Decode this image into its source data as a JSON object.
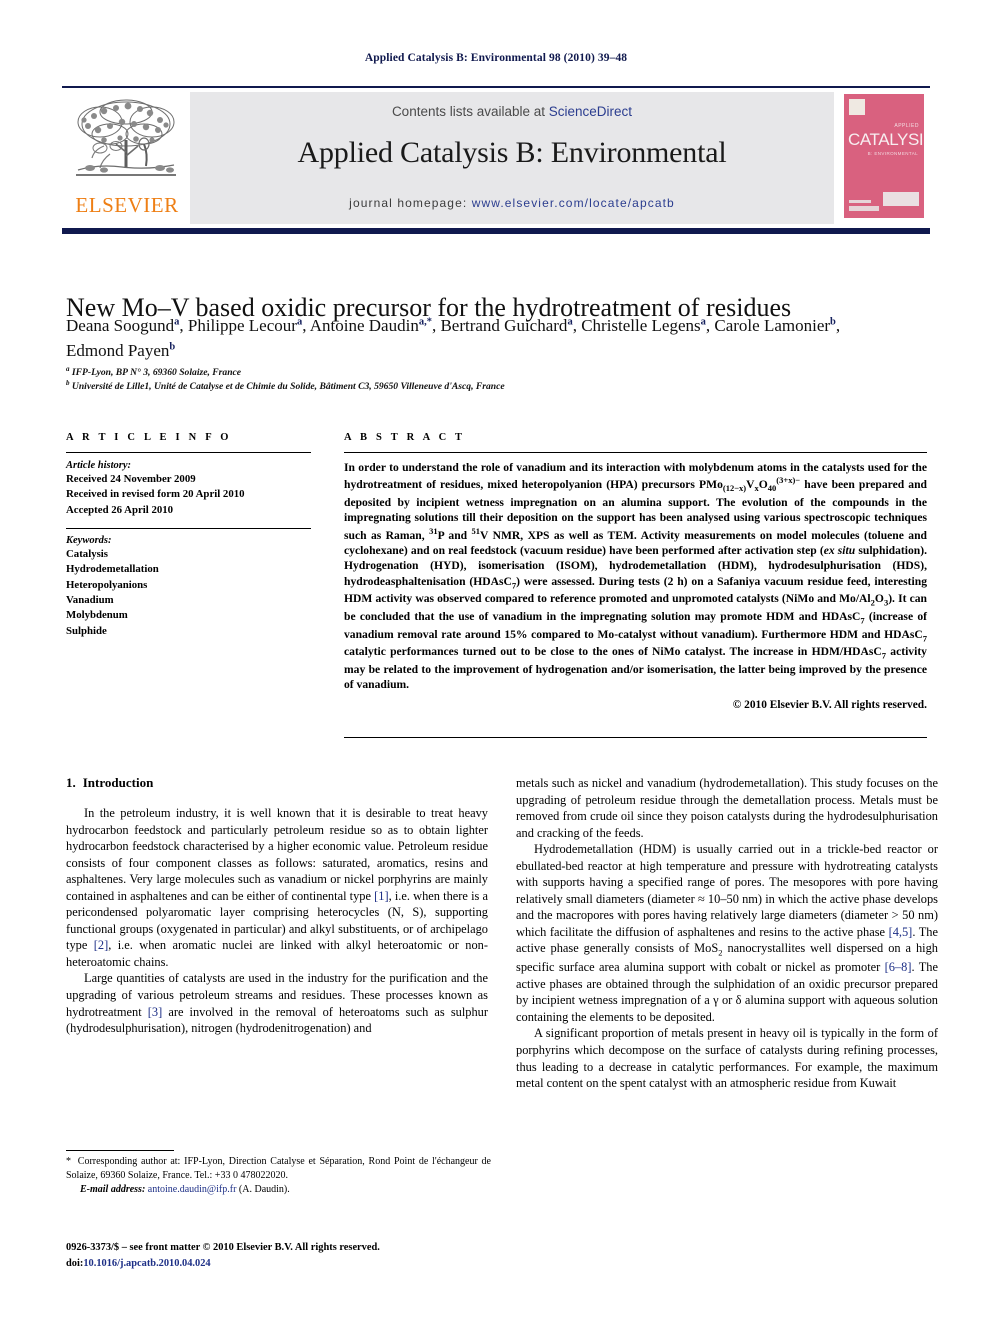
{
  "running_head": "Applied Catalysis B: Environmental 98 (2010) 39–48",
  "masthead": {
    "contents_prefix": "Contents lists available at ",
    "sciencedirect": "ScienceDirect",
    "journal_title": "Applied Catalysis B: Environmental",
    "homepage_label": "journal homepage:",
    "homepage_url": "www.elsevier.com/locate/apcatb",
    "publisher": "ELSEVIER",
    "cover": {
      "applied": "APPLIED",
      "catalysis": "CATALYSIS",
      "sub": "B: ENVIRONMENTAL"
    },
    "accent_navy": "#10194e",
    "accent_orange": "#ee7f15",
    "band_grey": "#e7e7e9",
    "cover_pink": "#d9617f",
    "link_blue": "#2b3d8f"
  },
  "article": {
    "title": "New Mo–V based oxidic precursor for the hydrotreatment of residues",
    "authors_line1": "Deana Soogund",
    "authors": [
      {
        "name": "Deana Soogund",
        "mark": "a"
      },
      {
        "name": "Philippe Lecour",
        "mark": "a"
      },
      {
        "name": "Antoine Daudin",
        "mark": "a,*"
      },
      {
        "name": "Bertrand Guichard",
        "mark": "a"
      },
      {
        "name": "Christelle Legens",
        "mark": "a"
      },
      {
        "name": "Carole Lamonier",
        "mark": "b"
      },
      {
        "name": "Edmond Payen",
        "mark": "b"
      }
    ],
    "affiliations": [
      {
        "mark": "a",
        "text": "IFP-Lyon, BP N° 3, 69360 Solaize, France"
      },
      {
        "mark": "b",
        "text": "Université de Lille1, Unité de Catalyse et de Chimie du Solide, Bâtiment C3, 59650 Villeneuve d'Ascq, France"
      }
    ]
  },
  "article_info": {
    "heading": "A R T I C L E   I N F O",
    "history_label": "Article history:",
    "history": [
      "Received 24 November 2009",
      "Received in revised form 20 April 2010",
      "Accepted 26 April 2010"
    ],
    "keywords_label": "Keywords:",
    "keywords": [
      "Catalysis",
      "Hydrodemetallation",
      "Heteropolyanions",
      "Vanadium",
      "Molybdenum",
      "Sulphide"
    ]
  },
  "abstract": {
    "heading": "A B S T R A C T",
    "paragraph_html": "In order to understand the role of vanadium and its interaction with molybdenum atoms in the catalysts used for the hydrotreatment of residues, mixed heteropolyanion (HPA) precursors PMo<sub>(12−x)</sub>V<sub>x</sub>O<sub>40</sub><sup>(3+x)−</sup> have been prepared and deposited by incipient wetness impregnation on an alumina support. The evolution of the compounds in the impregnating solutions till their deposition on the support has been analysed using various spectroscopic techniques such as Raman, <sup>31</sup>P and <sup>51</sup>V NMR, XPS as well as TEM. Activity measurements on model molecules (toluene and cyclohexane) and on real feedstock (vacuum residue) have been performed after activation step (<i>ex situ</i> sulphidation). Hydrogenation (HYD), isomerisation (ISOM), hydrodemetallation (HDM), hydrodesulphurisation (HDS), hydrodeasphaltenisation (HDAsC<sub>7</sub>) were assessed. During tests (2 h) on a Safaniya vacuum residue feed, interesting HDM activity was observed compared to reference promoted and unpromoted catalysts (NiMo and Mo/Al<sub>2</sub>O<sub>3</sub>). It can be concluded that the use of vanadium in the impregnating solution may promote HDM and HDAsC<sub>7</sub> (increase of vanadium removal rate around 15% compared to Mo-catalyst without vanadium). Furthermore HDM and HDAsC<sub>7</sub> catalytic performances turned out to be close to the ones of NiMo catalyst. The increase in HDM/HDAsC<sub>7</sub> activity may be related to the improvement of hydrogenation and/or isomerisation, the latter being improved by the presence of vanadium.",
    "copyright": "© 2010 Elsevier B.V. All rights reserved."
  },
  "body": {
    "section_number": "1.",
    "section_title": "Introduction",
    "left_paragraphs_html": [
      "In the petroleum industry, it is well known that it is desirable to treat heavy hydrocarbon feedstock and particularly petroleum residue so as to obtain lighter hydrocarbon feedstock characterised by a higher economic value. Petroleum residue consists of four component classes as follows: saturated, aromatics, resins and asphaltenes. Very large molecules such as vanadium or nickel porphyrins are mainly contained in asphaltenes and can be either of continental type <span class=\"ref\">[1]</span>, i.e. when there is a pericondensed polyaromatic layer comprising heterocycles (N, S), supporting functional groups (oxygenated in particular) and alkyl substituents, or of archipelago type <span class=\"ref\">[2]</span>, i.e. when aromatic nuclei are linked with alkyl heteroatomic or non-heteroatomic chains.",
      "Large quantities of catalysts are used in the industry for the purification and the upgrading of various petroleum streams and residues. These processes known as hydrotreatment <span class=\"ref\">[3]</span> are involved in the removal of heteroatoms such as sulphur (hydrodesulphurisation), nitrogen (hydrodenitrogenation) and"
    ],
    "right_paragraphs_html": [
      "metals such as nickel and vanadium (hydrodemetallation). This study focuses on the upgrading of petroleum residue through the demetallation process. Metals must be removed from crude oil since they poison catalysts during the hydrodesulphurisation and cracking of the feeds.",
      "Hydrodemetallation (HDM) is usually carried out in a trickle-bed reactor or ebullated-bed reactor at high temperature and pressure with hydrotreating catalysts with supports having a specified range of pores. The mesopores with pore having relatively small diameters (diameter ≈ 10–50 nm) in which the active phase develops and the macropores with pores having relatively large diameters (diameter &gt; 50 nm) which facilitate the diffusion of asphaltenes and resins to the active phase <span class=\"ref\">[4,5]</span>. The active phase generally consists of MoS<sub>2</sub> nanocrystallites well dispersed on a high specific surface area alumina support with cobalt or nickel as promoter <span class=\"ref\">[6–8]</span>. The active phases are obtained through the sulphidation of an oxidic precursor prepared by incipient wetness impregnation of a γ or δ alumina support with aqueous solution containing the elements to be deposited.",
      "A significant proportion of metals present in heavy oil is typically in the form of porphyrins which decompose on the surface of catalysts during refining processes, thus leading to a decrease in catalytic performances. For example, the maximum metal content on the spent catalyst with an atmospheric residue from Kuwait"
    ]
  },
  "footnotes": {
    "corresponding_star": "*",
    "corresponding_text": "Corresponding author at: IFP-Lyon, Direction Catalyse et Séparation, Rond Point de l'échangeur de Solaize, 69360 Solaize, France. Tel.: +33 0 478022020.",
    "email_label": "E-mail address:",
    "email": "antoine.daudin@ifp.fr",
    "email_suffix": "(A. Daudin).",
    "issn_line": "0926-3373/$ – see front matter © 2010 Elsevier B.V. All rights reserved.",
    "doi_label": "doi:",
    "doi_value": "10.1016/j.apcatb.2010.04.024"
  }
}
